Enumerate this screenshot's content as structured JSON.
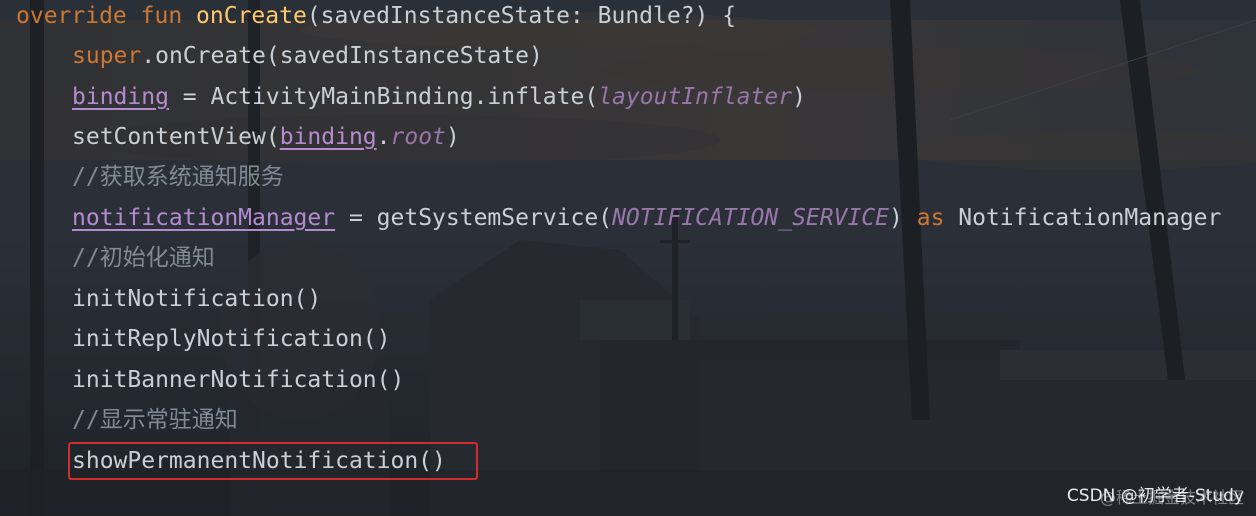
{
  "code": {
    "line1": {
      "kw_override": "override",
      "kw_fun": "fun",
      "fn_name": "onCreate",
      "params": "(savedInstanceState: Bundle?) {"
    },
    "line2": {
      "kw_super": "super",
      "rest": ".onCreate(savedInstanceState)"
    },
    "line3": {
      "prop": "binding",
      "mid": " = ActivityMainBinding.inflate(",
      "ital": "layoutInflater",
      "end": ")"
    },
    "line4": {
      "start": "setContentView(",
      "prop": "binding",
      "dot": ".",
      "ital": "root",
      "end": ")"
    },
    "line5": {
      "comment": "//获取系统通知服务"
    },
    "line6": {
      "prop": "notificationManager",
      "mid": " = getSystemService(",
      "ital": "NOTIFICATION_SERVICE",
      "close": ") ",
      "kw_as": "as",
      "type": " NotificationManager"
    },
    "line7": {
      "comment": "//初始化通知"
    },
    "line8": {
      "text": "initNotification()"
    },
    "line9": {
      "text": "initReplyNotification()"
    },
    "line10": {
      "text": "initBannerNotification()"
    },
    "line11": {
      "comment": "//显示常驻通知"
    },
    "line12": {
      "text": "showPermanentNotification()"
    }
  },
  "watermark": {
    "main": "CSDN @初学者-Study",
    "sub": "@稀土掘金技术社区"
  },
  "colors": {
    "keyword": "#cc7832",
    "function": "#ffc66d",
    "property": "#b58bd0",
    "italic": "#9876aa",
    "comment": "#808a94",
    "highlight_border": "#d22d2d"
  }
}
